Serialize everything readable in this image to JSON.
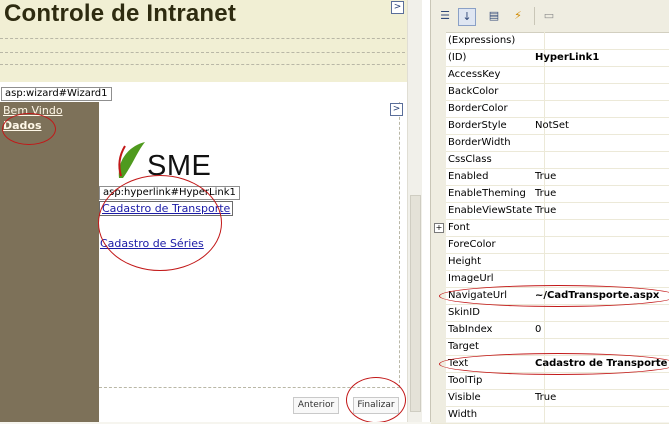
{
  "designer": {
    "page_title": "Controle de Intranet",
    "wizard_tag": "asp:wizard#Wizard1",
    "sidebar_links": [
      "Bem Vindo",
      "Dados"
    ],
    "logo_text": "SME",
    "hyperlink_tag": "asp:hyperlink#HyperLink1",
    "links": [
      "Cadastro de Transporte",
      "Cadastro de Séries"
    ],
    "buttons": {
      "previous": "Anterior",
      "finish": "Finalizar"
    },
    "smart_tag_glyph": ">"
  },
  "properties": {
    "toolbar_icons": [
      "categorized-icon",
      "alphabetical-icon",
      "properties-icon",
      "events-icon",
      "property-pages-icon"
    ],
    "rows": [
      {
        "name": "(Expressions)",
        "value": ""
      },
      {
        "name": "(ID)",
        "value": "HyperLink1",
        "bold": true
      },
      {
        "name": "AccessKey",
        "value": ""
      },
      {
        "name": "BackColor",
        "value": ""
      },
      {
        "name": "BorderColor",
        "value": ""
      },
      {
        "name": "BorderStyle",
        "value": "NotSet"
      },
      {
        "name": "BorderWidth",
        "value": ""
      },
      {
        "name": "CssClass",
        "value": ""
      },
      {
        "name": "Enabled",
        "value": "True"
      },
      {
        "name": "EnableTheming",
        "value": "True"
      },
      {
        "name": "EnableViewState",
        "value": "True"
      },
      {
        "name": "Font",
        "value": "",
        "expandable": true
      },
      {
        "name": "ForeColor",
        "value": ""
      },
      {
        "name": "Height",
        "value": ""
      },
      {
        "name": "ImageUrl",
        "value": ""
      },
      {
        "name": "NavigateUrl",
        "value": "~/CadTransporte.aspx",
        "bold": true
      },
      {
        "name": "SkinID",
        "value": ""
      },
      {
        "name": "TabIndex",
        "value": "0"
      },
      {
        "name": "Target",
        "value": ""
      },
      {
        "name": "Text",
        "value": "Cadastro de Transporte",
        "bold": true
      },
      {
        "name": "ToolTip",
        "value": ""
      },
      {
        "name": "Visible",
        "value": "True"
      },
      {
        "name": "Width",
        "value": ""
      }
    ]
  },
  "colors": {
    "header_bg": "#f1efd4",
    "sidebar_bg": "#7d7159",
    "annotation_red": "#c21818",
    "link_blue": "#1a1aa6",
    "logo_green": "#4f9a1e"
  }
}
